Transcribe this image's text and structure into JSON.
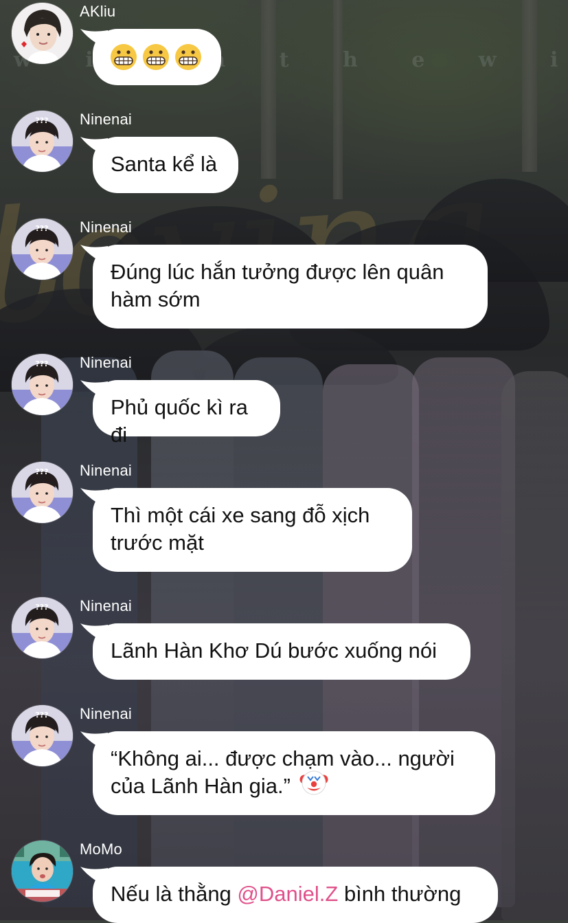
{
  "background": {
    "watermark_text": "w i t h   t h e   w i n d   r i g h"
  },
  "messages": [
    {
      "sender": "AKliu",
      "avatar_icon": "person-avatar-akliu",
      "emoji_icon": "grimacing-face-emoji"
    },
    {
      "sender": "Ninenai",
      "avatar_icon": "person-avatar-ninenai",
      "text": "Santa kể là"
    },
    {
      "sender": "Ninenai",
      "avatar_icon": "person-avatar-ninenai",
      "text_line1": "Đúng lúc hắn tưởng được lên quân",
      "text_line2": "hàm sớm"
    },
    {
      "sender": "Ninenai",
      "avatar_icon": "person-avatar-ninenai",
      "text": "Phủ quốc kì ra đi"
    },
    {
      "sender": "Ninenai",
      "avatar_icon": "person-avatar-ninenai",
      "text_line1": "Thì một cái xe sang đỗ xịch",
      "text_line2": "trước mặt"
    },
    {
      "sender": "Ninenai",
      "avatar_icon": "person-avatar-ninenai",
      "text": "Lãnh Hàn Khơ Dú bước xuống nói"
    },
    {
      "sender": "Ninenai",
      "avatar_icon": "person-avatar-ninenai",
      "text_line1": "“Không ai... được chạm vào... người",
      "text_line2": "của Lãnh Hàn gia.”",
      "emoji_icon": "clown-face-emoji"
    },
    {
      "sender": "MoMo",
      "avatar_icon": "person-avatar-momo",
      "text_before": "Nếu là thằng ",
      "mention": "@Daniel.Z",
      "text_after": " bình thường"
    }
  ],
  "colors": {
    "bubble": "#ffffff",
    "text": "#111111",
    "mention": "#e0508a",
    "sender": "#ffffff"
  }
}
